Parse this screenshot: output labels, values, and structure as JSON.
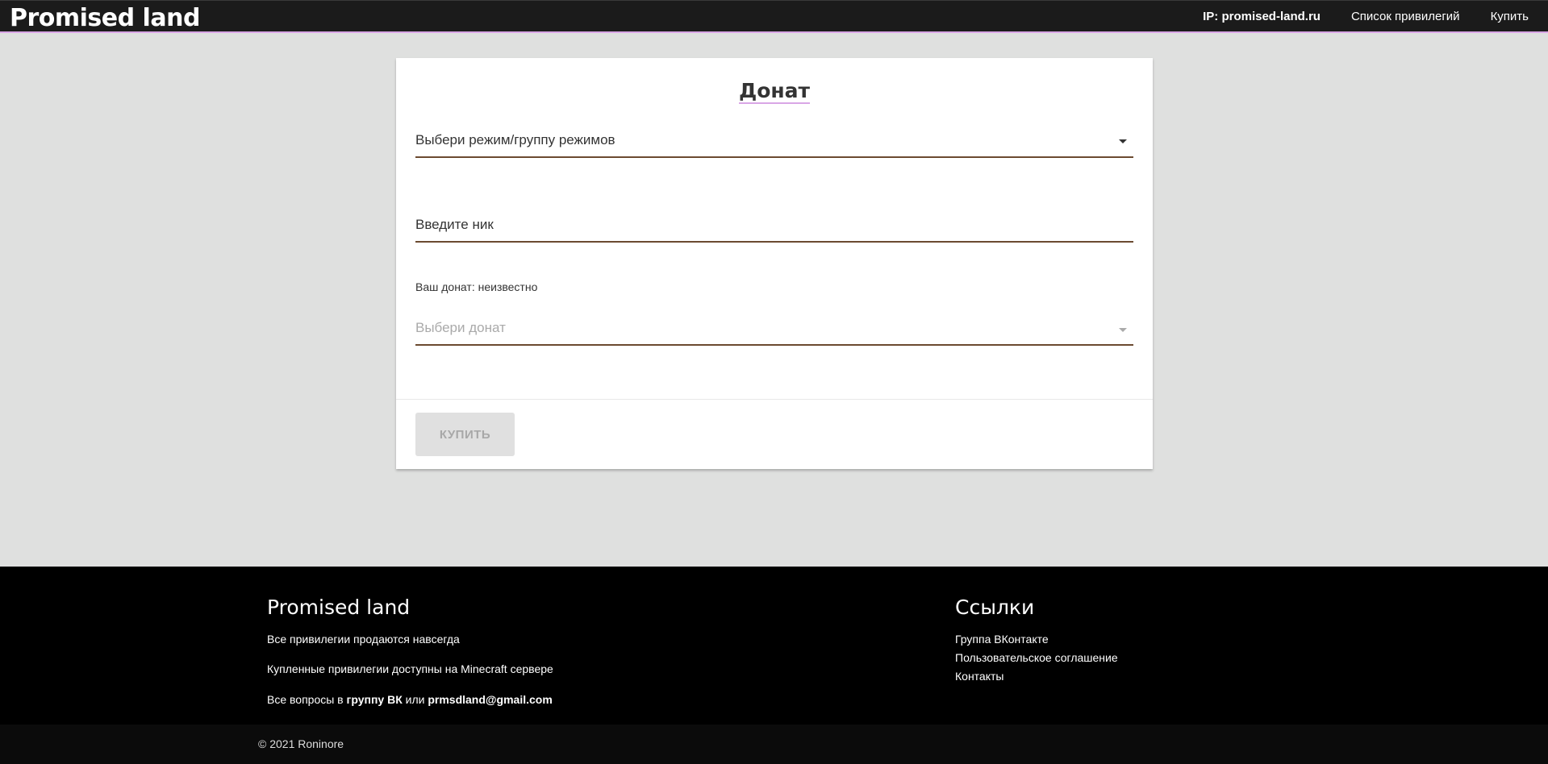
{
  "header": {
    "brand": "Promised land",
    "nav": {
      "ip": "IP: promised-land.ru",
      "privileges": "Список привилегий",
      "buy": "Купить"
    }
  },
  "form": {
    "title": "Донат",
    "mode_select": "Выбери режим/группу режимов",
    "nick_field": "Введите ник",
    "donate_status": "Ваш донат: неизвестно",
    "donate_select": "Выбери донат",
    "buy_button": "КУПИТЬ"
  },
  "footer": {
    "title": "Promised land",
    "line1": "Все привилегии продаются навсегда",
    "line2": "Купленные привилегии доступны на Minecraft сервере",
    "line3_prefix": "Все вопросы в ",
    "line3_link": "группу ВК",
    "line3_middle": " или ",
    "line3_email": "prmsdland@gmail.com",
    "links_title": "Ссылки",
    "links": [
      "Группа ВКонтакте",
      "Пользовательское соглашение",
      "Контакты"
    ],
    "copyright": "© 2021 Roninore"
  },
  "colors": {
    "header_bg": "#1b1b1b",
    "accent_underline": "#d9a6e6",
    "field_underline": "#6b4a30",
    "page_bg": "#dfe0df",
    "footer_bg": "#000000"
  }
}
